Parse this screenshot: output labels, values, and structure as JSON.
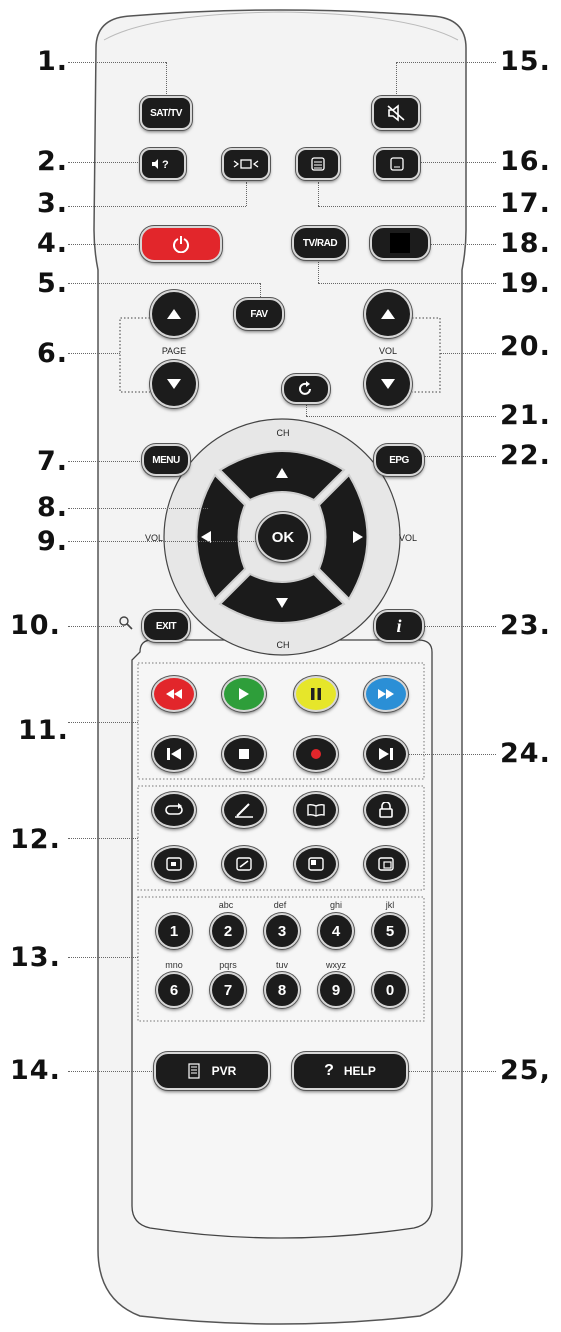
{
  "callouts": {
    "left": [
      "1.",
      "2.",
      "3.",
      "4.",
      "5.",
      "6.",
      "7.",
      "8.",
      "9.",
      "10.",
      "11.",
      "12.",
      "13.",
      "14."
    ],
    "right": [
      "15.",
      "16.",
      "17.",
      "18.",
      "19.",
      "20.",
      "21.",
      "22.",
      "23.",
      "24.",
      "25,"
    ]
  },
  "buttons": {
    "sat_tv": "SAT/TV",
    "tv_rad": "TV/RAD",
    "fav": "FAV",
    "menu": "MENU",
    "epg": "EPG",
    "ok": "OK",
    "exit": "EXIT",
    "info": "i",
    "pvr": "PVR",
    "help": "HELP",
    "help_glyph": "?"
  },
  "labels": {
    "page": "PAGE",
    "vol_right": "VOL",
    "ch_top": "CH",
    "ch_bottom": "CH",
    "vol_dpad_left": "VOL",
    "vol_dpad_right": "VOL"
  },
  "numpad": {
    "row1": [
      {
        "digit": "1",
        "letters": ""
      },
      {
        "digit": "2",
        "letters": "abc"
      },
      {
        "digit": "3",
        "letters": "def"
      },
      {
        "digit": "4",
        "letters": "ghi"
      },
      {
        "digit": "5",
        "letters": "jkl"
      }
    ],
    "row2": [
      {
        "digit": "6",
        "letters": "mno"
      },
      {
        "digit": "7",
        "letters": "pqrs"
      },
      {
        "digit": "8",
        "letters": "tuv"
      },
      {
        "digit": "9",
        "letters": "wxyz"
      },
      {
        "digit": "0",
        "letters": ""
      }
    ]
  },
  "colors": {
    "power": "#e2262b",
    "rewind": "#e2262b",
    "play": "#2e9e3a",
    "pause": "#e6e62a",
    "fast_forward": "#2b8fd6"
  },
  "icons": {
    "row12_top": [
      "repeat-icon",
      "edit-icon",
      "book-icon",
      "lock-icon"
    ],
    "row12_bottom": [
      "pip-icon",
      "zoom-icon",
      "aspect-icon",
      "swap-icon"
    ]
  }
}
